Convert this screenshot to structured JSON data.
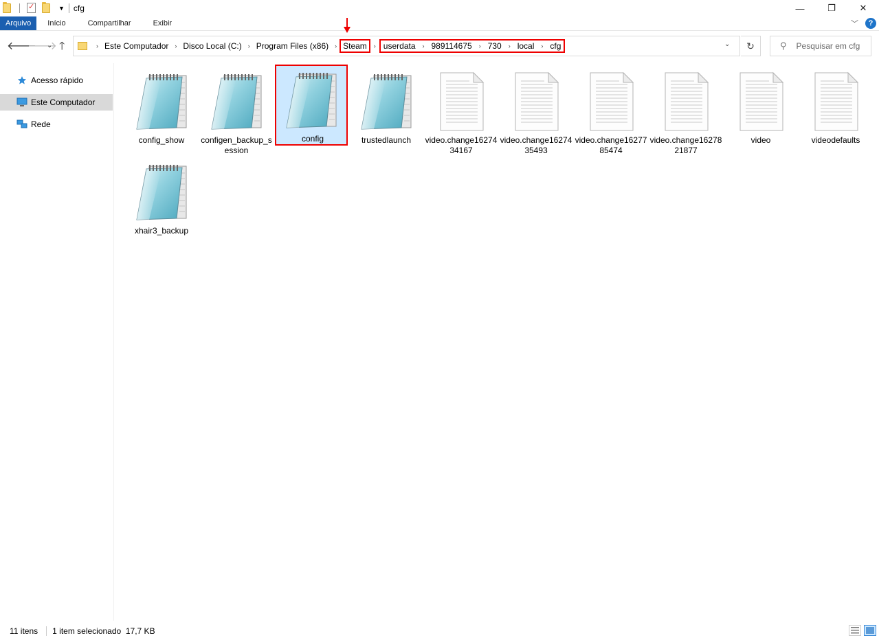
{
  "window": {
    "title": "cfg"
  },
  "ribbon": {
    "tabs": [
      "Arquivo",
      "Início",
      "Compartilhar",
      "Exibir"
    ]
  },
  "address": {
    "crumbs": [
      "Este Computador",
      "Disco Local (C:)",
      "Program Files (x86)"
    ],
    "highlighted_crumb": "Steam",
    "highlighted_path": [
      "userdata",
      "989114675",
      "730",
      "local",
      "cfg"
    ]
  },
  "search": {
    "placeholder": "Pesquisar em cfg"
  },
  "sidebar": {
    "items": [
      {
        "label": "Acesso rápido",
        "icon": "star-icon"
      },
      {
        "label": "Este Computador",
        "icon": "computer-icon"
      },
      {
        "label": "Rede",
        "icon": "network-icon"
      }
    ]
  },
  "files": [
    {
      "name": "config_show",
      "type": "notepad"
    },
    {
      "name": "configen_backup_session",
      "type": "notepad"
    },
    {
      "name": "config",
      "type": "notepad",
      "selected": true
    },
    {
      "name": "trustedlaunch",
      "type": "notepad"
    },
    {
      "name": "video.change1627434167",
      "type": "document"
    },
    {
      "name": "video.change1627435493",
      "type": "document"
    },
    {
      "name": "video.change1627785474",
      "type": "document"
    },
    {
      "name": "video.change1627821877",
      "type": "document"
    },
    {
      "name": "video",
      "type": "document"
    },
    {
      "name": "videodefaults",
      "type": "document"
    },
    {
      "name": "xhair3_backup",
      "type": "notepad"
    }
  ],
  "status": {
    "count": "11 itens",
    "selection": "1 item selecionado  17,7 KB"
  },
  "colors": {
    "highlight": "#e00000",
    "selection_bg": "#cce8ff",
    "file_tab": "#1b5fb0"
  }
}
